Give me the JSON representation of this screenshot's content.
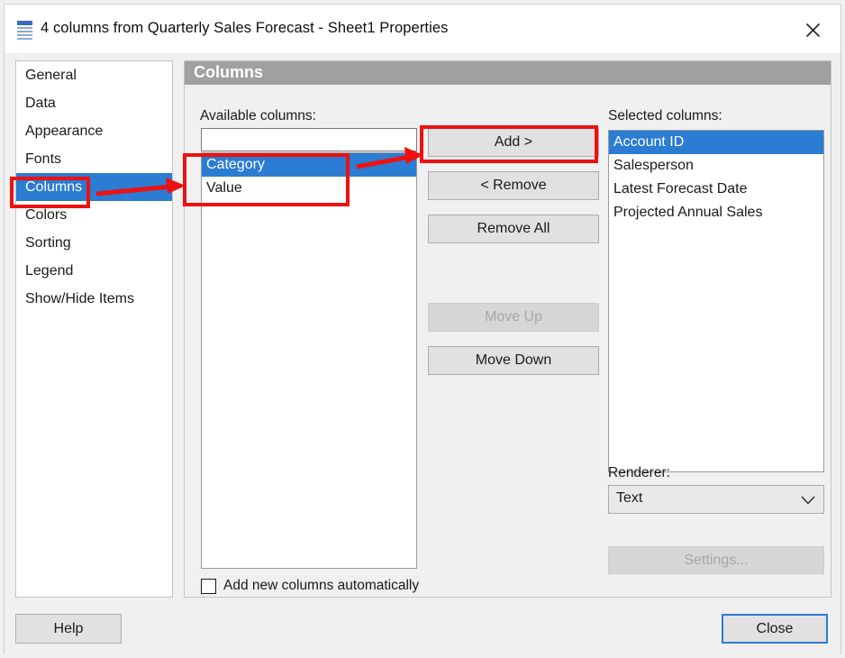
{
  "window": {
    "title": "4 columns from Quarterly Sales Forecast - Sheet1 Properties",
    "icon": "list-grid-icon",
    "close_icon": "close-icon"
  },
  "sidebar": {
    "items": [
      {
        "label": "General",
        "selected": false
      },
      {
        "label": "Data",
        "selected": false
      },
      {
        "label": "Appearance",
        "selected": false
      },
      {
        "label": "Fonts",
        "selected": false
      },
      {
        "label": "Columns",
        "selected": true
      },
      {
        "label": "Colors",
        "selected": false
      },
      {
        "label": "Sorting",
        "selected": false
      },
      {
        "label": "Legend",
        "selected": false
      },
      {
        "label": "Show/Hide Items",
        "selected": false
      }
    ]
  },
  "panel": {
    "header": "Columns",
    "available_label": "Available columns:",
    "selected_label": "Selected columns:",
    "renderer_label": "Renderer:",
    "filter_value": "",
    "filter_placeholder": "",
    "available_columns": [
      {
        "label": "Category",
        "selected": true
      },
      {
        "label": "Value",
        "selected": false
      }
    ],
    "selected_columns": [
      {
        "label": "Account ID",
        "selected": true
      },
      {
        "label": "Salesperson",
        "selected": false
      },
      {
        "label": "Latest Forecast Date",
        "selected": false
      },
      {
        "label": "Projected Annual Sales",
        "selected": false
      }
    ],
    "buttons": {
      "add": "Add >",
      "remove": "< Remove",
      "remove_all": "Remove All",
      "move_up": "Move Up",
      "move_down": "Move Down",
      "settings": "Settings..."
    },
    "renderer_value": "Text",
    "chevron_icon": "chevron-down-icon",
    "auto_add_label": "Add new columns automatically",
    "auto_add_checked": false
  },
  "footer": {
    "help": "Help",
    "close": "Close"
  },
  "annotations": {
    "accent_color": "#ee1111",
    "highlight_color": "#2b7cd3",
    "header_color": "#a0a0a0"
  }
}
